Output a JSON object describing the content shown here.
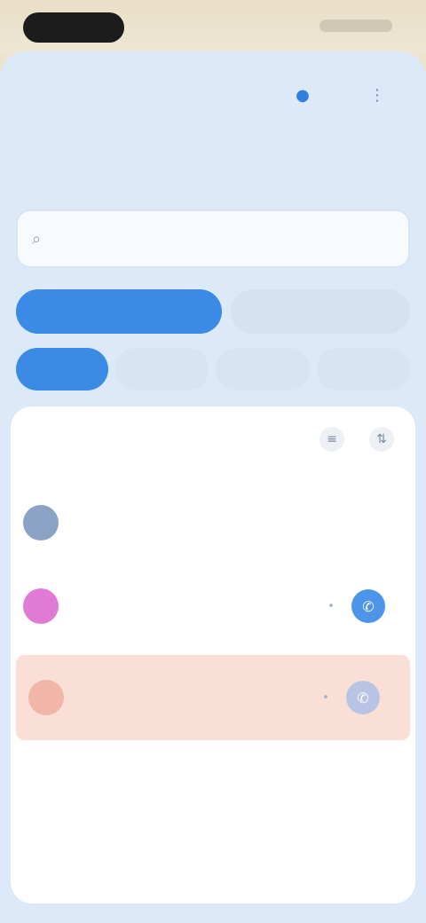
{
  "status_bar": {},
  "header": {
    "title": "",
    "icons": [
      "bell-icon",
      "more-icon"
    ]
  },
  "search": {
    "placeholder": "",
    "icon": "search-icon"
  },
  "segments": [
    {
      "label": "",
      "active": true
    },
    {
      "label": "",
      "active": false
    }
  ],
  "chips": [
    {
      "label": "",
      "active": true
    },
    {
      "label": "",
      "active": false
    },
    {
      "label": "",
      "active": false
    },
    {
      "label": "",
      "active": false
    }
  ],
  "list": {
    "title": "",
    "header_icons": [
      "filter-icon",
      "sort-icon"
    ],
    "items": [
      {
        "avatar": "",
        "title": "",
        "subtitle": "",
        "highlight": false
      },
      {
        "avatar": "",
        "title": "",
        "subtitle": "",
        "highlight": false
      },
      {
        "avatar": "",
        "title": "",
        "subtitle": "",
        "highlight": true
      }
    ]
  },
  "colors": {
    "accent": "#3a8ae6",
    "background": "#dce9f8",
    "highlight_row": "#f9dfd6",
    "pink_avatar": "#e07ad5"
  }
}
